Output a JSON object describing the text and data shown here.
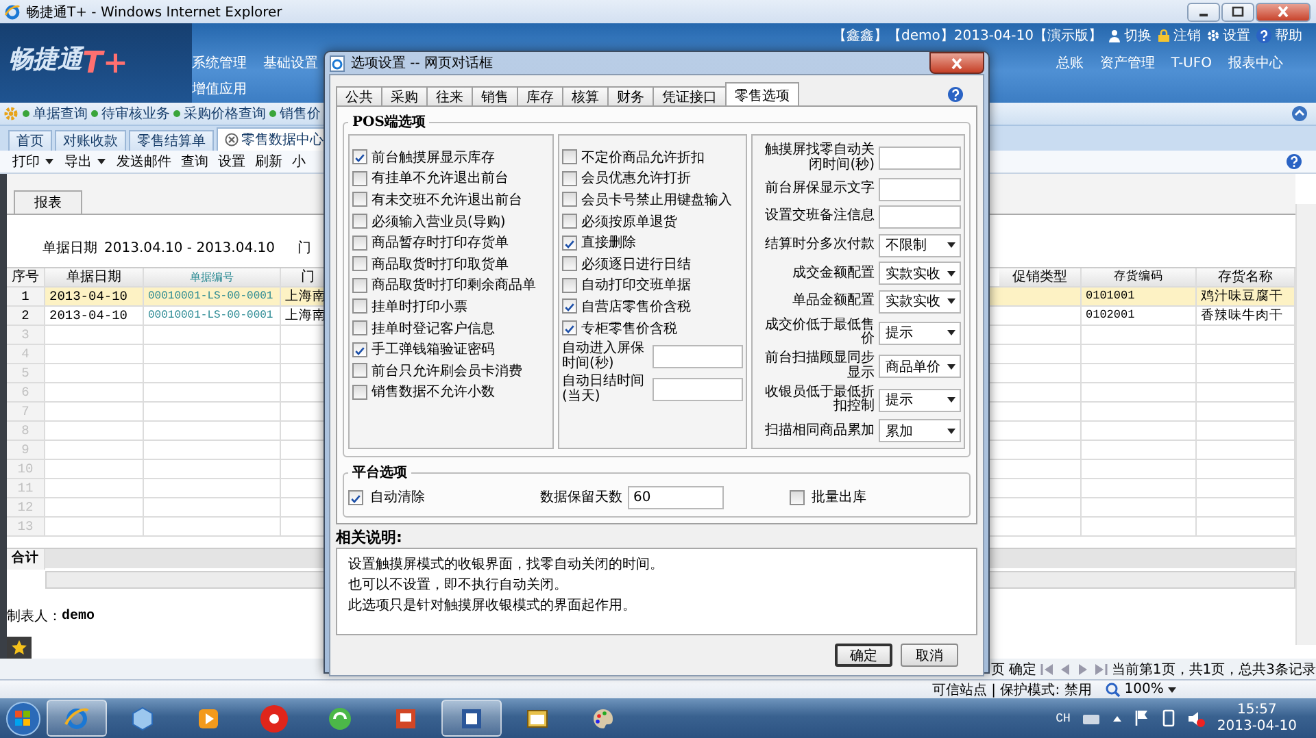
{
  "browser": {
    "title": "畅捷通T+ - Windows Internet Explorer",
    "status_zone": "可信站点 | 保护模式: 禁用",
    "zoom": "100%"
  },
  "app": {
    "logo_text": "畅捷通",
    "logo_mark": "T+",
    "user_info": "【鑫鑫】【demo】2013-04-10【演示版】",
    "user_links": [
      "切换",
      "注销",
      "设置",
      "帮助"
    ],
    "menu_left": [
      "系统管理",
      "基础设置"
    ],
    "menu_left_row2": [
      "增值应用"
    ],
    "menu_right": [
      "总账",
      "资产管理",
      "T-UFO",
      "报表中心"
    ],
    "quick_links": [
      "单据查询",
      "待审核业务",
      "采购价格查询",
      "销售价"
    ],
    "tabs": [
      {
        "label": "首页",
        "selected": false,
        "closable": false
      },
      {
        "label": "对账收款",
        "selected": false,
        "closable": false
      },
      {
        "label": "零售结算单",
        "selected": false,
        "closable": false
      },
      {
        "label": "零售数据中心",
        "selected": true,
        "closable": true
      }
    ],
    "toolbar": [
      {
        "label": "打印",
        "dropdown": true
      },
      {
        "label": "导出",
        "dropdown": true
      },
      {
        "label": "发送邮件",
        "dropdown": false
      },
      {
        "label": "查询",
        "dropdown": false
      },
      {
        "label": "设置",
        "dropdown": false
      },
      {
        "label": "刷新",
        "dropdown": false
      },
      {
        "label": "小",
        "dropdown": false
      }
    ],
    "report_tab": "报表",
    "date_range": {
      "label": "单据日期",
      "value": "2013.04.10 - 2013.04.10",
      "next_label": "门"
    },
    "table": {
      "columns_left": [
        "序号",
        "单据日期",
        "单据编号",
        "门"
      ],
      "columns_right": [
        "促销类型",
        "存货编码",
        "存货名称"
      ],
      "rows": [
        {
          "index": "1",
          "date": "2013-04-10",
          "code": "00010001-LS-00-0001",
          "store": "上海南",
          "item_code": "0101001",
          "item_name": "鸡汁味豆腐干",
          "selected": true
        },
        {
          "index": "2",
          "date": "2013-04-10",
          "code": "00010001-LS-00-0001",
          "store": "上海南",
          "item_code": "0102001",
          "item_name": "香辣味牛肉干",
          "selected": false
        }
      ],
      "empty_rows": [
        "3",
        "4",
        "5",
        "6",
        "7",
        "8",
        "9",
        "10",
        "11",
        "12",
        "13"
      ],
      "total_label": "合计"
    },
    "maker": {
      "label": "制表人：",
      "value": "demo"
    },
    "pager": {
      "before": "页",
      "confirm": "确定",
      "info": "当前第1页，共1页，总共3条记录"
    }
  },
  "dialog": {
    "title": "选项设置 -- 网页对话框",
    "tabs": [
      {
        "label": "公共",
        "selected": false
      },
      {
        "label": "采购",
        "selected": false
      },
      {
        "label": "往来",
        "selected": false
      },
      {
        "label": "销售",
        "selected": false
      },
      {
        "label": "库存",
        "selected": false
      },
      {
        "label": "核算",
        "selected": false
      },
      {
        "label": "财务",
        "selected": false
      },
      {
        "label": "凭证接口",
        "selected": false
      },
      {
        "label": "零售选项",
        "selected": true
      }
    ],
    "pos_group": {
      "title": "POS端选项",
      "column_1": [
        {
          "label": "前台触摸屏显示库存",
          "checked": true
        },
        {
          "label": "有挂单不允许退出前台",
          "checked": false
        },
        {
          "label": "有未交班不允许退出前台",
          "checked": false
        },
        {
          "label": "必须输入营业员(导购)",
          "checked": false
        },
        {
          "label": "商品暂存时打印存货单",
          "checked": false
        },
        {
          "label": "商品取货时打印取货单",
          "checked": false
        },
        {
          "label": "商品取货时打印剩余商品单",
          "checked": false
        },
        {
          "label": "挂单时打印小票",
          "checked": false
        },
        {
          "label": "挂单时登记客户信息",
          "checked": false
        },
        {
          "label": "手工弹钱箱验证密码",
          "checked": true
        },
        {
          "label": "前台只允许刷会员卡消费",
          "checked": false
        },
        {
          "label": "销售数据不允许小数",
          "checked": false
        }
      ],
      "column_2": [
        {
          "kind": "checkbox",
          "label": "不定价商品允许折扣",
          "checked": false
        },
        {
          "kind": "checkbox",
          "label": "会员优惠允许打折",
          "checked": false
        },
        {
          "kind": "checkbox",
          "label": "会员卡号禁止用键盘输入",
          "checked": false
        },
        {
          "kind": "checkbox",
          "label": "必须按原单退货",
          "checked": false
        },
        {
          "kind": "checkbox",
          "label": "直接删除",
          "checked": true
        },
        {
          "kind": "checkbox",
          "label": "必须逐日进行日结",
          "checked": false
        },
        {
          "kind": "checkbox",
          "label": "自动打印交班单据",
          "checked": false
        },
        {
          "kind": "checkbox",
          "label": "自营店零售价含税",
          "checked": true
        },
        {
          "kind": "checkbox",
          "label": "专柜零售价含税",
          "checked": true
        },
        {
          "kind": "field",
          "label": "自动进入屏保时间(秒)"
        },
        {
          "kind": "field",
          "label": "自动日结时间(当天)"
        }
      ],
      "column_3": [
        {
          "kind": "field",
          "label": "触摸屏找零自动关闭时间(秒)"
        },
        {
          "kind": "field",
          "label": "前台屏保显示文字"
        },
        {
          "kind": "field",
          "label": "设置交班备注信息"
        },
        {
          "kind": "select",
          "label": "结算时分多次付款",
          "value": "不限制"
        },
        {
          "kind": "select",
          "label": "成交金额配置",
          "value": "实款实收"
        },
        {
          "kind": "select",
          "label": "单品金额配置",
          "value": "实款实收"
        },
        {
          "kind": "select",
          "label": "成交价低于最低售价",
          "value": "提示"
        },
        {
          "kind": "select",
          "label": "前台扫描顾显同步显示",
          "value": "商品单价"
        },
        {
          "kind": "select",
          "label": "收银员低于最低折扣控制",
          "value": "提示"
        },
        {
          "kind": "select",
          "label": "扫描相同商品累加",
          "value": "累加"
        }
      ]
    },
    "platform_group": {
      "title": "平台选项",
      "auto_clear": {
        "label": "自动清除",
        "checked": true
      },
      "retention": {
        "label": "数据保留天数",
        "value": "60"
      },
      "batch_out": {
        "label": "批量出库",
        "checked": false
      }
    },
    "notes": {
      "title": "相关说明:",
      "lines": [
        "设置触摸屏模式的收银界面，找零自动关闭的时间。",
        "也可以不设置，即不执行自动关闭。",
        "此选项只是针对触摸屏收银模式的界面起作用。"
      ]
    },
    "buttons": [
      "确定",
      "取消"
    ]
  },
  "taskbar": {
    "lang": "CH",
    "time": "15:57",
    "date": "2013-04-10"
  }
}
